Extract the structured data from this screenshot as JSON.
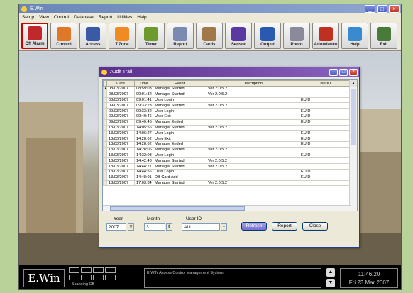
{
  "app": {
    "title": "E.Win"
  },
  "menu": [
    "Setup",
    "View",
    "Control",
    "Database",
    "Report",
    "Utilities",
    "Help"
  ],
  "toolbar": [
    {
      "label": "Off Alarm",
      "color": "#c0282b",
      "icon": "alarm-icon"
    },
    {
      "label": "Control",
      "color": "#e0782a",
      "icon": "control-icon"
    },
    {
      "label": "Access",
      "color": "#3a5aa8",
      "icon": "access-icon"
    },
    {
      "label": "T.Zone",
      "color": "#f08a22",
      "icon": "timezone-icon"
    },
    {
      "label": "Timer",
      "color": "#6c9a2c",
      "icon": "timer-icon"
    },
    {
      "label": "Report",
      "color": "#7a8ab0",
      "icon": "report-icon"
    },
    {
      "label": "Cards",
      "color": "#a0784a",
      "icon": "cards-icon"
    },
    {
      "label": "Sensor",
      "color": "#5a3aa0",
      "icon": "sensor-icon"
    },
    {
      "label": "Output",
      "color": "#2a5ab0",
      "icon": "output-icon"
    },
    {
      "label": "Photo",
      "color": "#8a8a9a",
      "icon": "photo-icon"
    },
    {
      "label": "Attendance",
      "color": "#c03020",
      "icon": "attendance-icon"
    },
    {
      "label": "Help",
      "color": "#3a8ad0",
      "icon": "help-icon"
    },
    {
      "label": "Exit",
      "color": "#4a7a3a",
      "icon": "exit-icon"
    }
  ],
  "dialog": {
    "title": "Audit Trail",
    "columns": [
      "Date",
      "Time",
      "Event",
      "Description",
      "UserID"
    ],
    "rows": [
      [
        "08/03/2007",
        "08:59:03",
        "Manager Started",
        "Ver 2.0.5.2",
        ""
      ],
      [
        "08/03/2007",
        "09:01:32",
        "Manager Started",
        "Ver 2.0.5.2",
        ""
      ],
      [
        "08/03/2007",
        "09:01:41",
        "User Login",
        "",
        "EUID"
      ],
      [
        "09/03/2007",
        "09:33:23",
        "Manager Started",
        "Ver 2.0.5.2",
        ""
      ],
      [
        "09/03/2007",
        "09:33:32",
        "User Login",
        "",
        "EUID"
      ],
      [
        "09/03/2007",
        "09:40:46",
        "User Exit",
        "",
        "EUID"
      ],
      [
        "09/03/2007",
        "09:40:46",
        "Manager Ended",
        "",
        "EUID"
      ],
      [
        "13/03/2007",
        "14:05:56",
        "Manager Started",
        "Ver 2.0.5.2",
        ""
      ],
      [
        "13/03/2007",
        "14:06:27",
        "User Login",
        "",
        "EUID"
      ],
      [
        "13/03/2007",
        "14:28:02",
        "User Exit",
        "",
        "EUID"
      ],
      [
        "13/03/2007",
        "14:28:02",
        "Manager Ended",
        "",
        "EUID"
      ],
      [
        "13/03/2007",
        "14:28:06",
        "Manager Started",
        "Ver 2.0.5.2",
        ""
      ],
      [
        "13/03/2007",
        "14:32:03",
        "User Login",
        "",
        "EUID"
      ],
      [
        "13/03/2007",
        "14:42:48",
        "Manager Started",
        "Ver 2.0.5.2",
        ""
      ],
      [
        "13/03/2007",
        "14:44:27",
        "Manager Started",
        "Ver 2.0.5.2",
        ""
      ],
      [
        "13/03/2007",
        "14:44:56",
        "User Login",
        "",
        "EUID"
      ],
      [
        "13/03/2007",
        "14:48:01",
        "DB Card Add",
        "",
        "EUID"
      ],
      [
        "13/03/2007",
        "17:03:34",
        "Manager Started",
        "Ver 2.0.5.2",
        ""
      ]
    ],
    "year_label": "Year",
    "year_value": "2007",
    "month_label": "Month",
    "month_value": "3",
    "userid_label": "User ID",
    "userid_value": "ALL",
    "refresh_label": "Refresh",
    "report_label": "Report",
    "close_label": "Close"
  },
  "status": {
    "logo": "E.Win",
    "scanning": "Scanning Off",
    "system_name": "E.WIN Access Control Management System",
    "time": "11:46:20",
    "date": "Fri  23 Mar 2007"
  }
}
